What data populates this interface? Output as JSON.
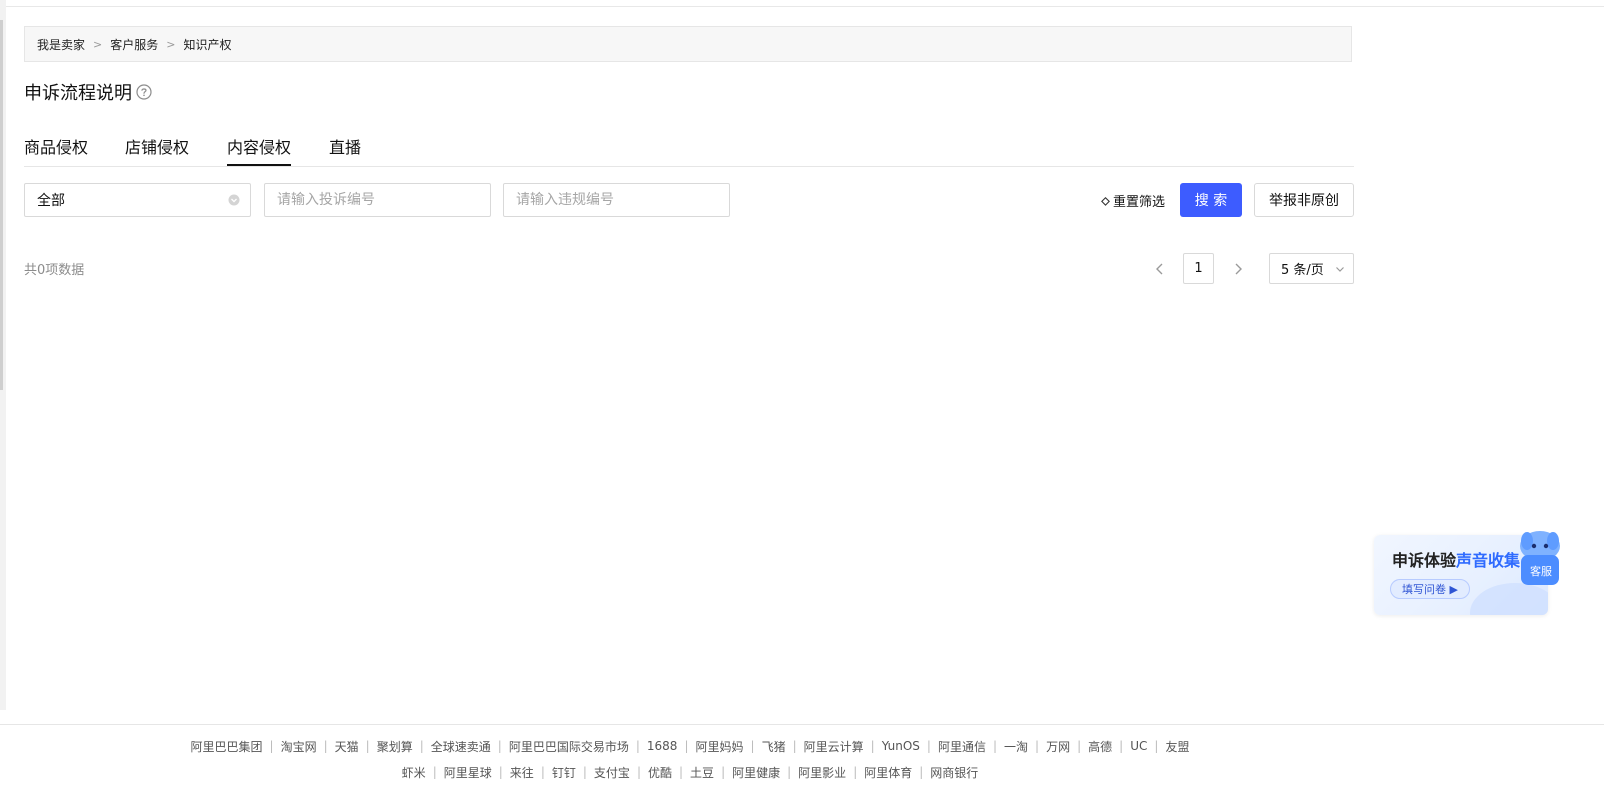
{
  "breadcrumb": [
    "我是卖家",
    "客户服务",
    "知识产权"
  ],
  "page_title": "申诉流程说明",
  "tabs": [
    {
      "label": "商品侵权"
    },
    {
      "label": "店铺侵权"
    },
    {
      "label": "内容侵权",
      "active": true
    },
    {
      "label": "直播"
    }
  ],
  "filters": {
    "type_select_value": "全部",
    "complaint_no_placeholder": "请输入投诉编号",
    "violation_no_placeholder": "请输入违规编号",
    "reset_label": "重置筛选",
    "search_label": "搜 索",
    "report_label": "举报非原创"
  },
  "results": {
    "total_text": "共0项数据"
  },
  "pagination": {
    "current_page": "1",
    "page_size": "5 条/页"
  },
  "survey": {
    "title_main": "申诉体验",
    "title_highlight": "声音收集",
    "button_label": "填写问卷 ▶"
  },
  "customer_service": {
    "label": "客服"
  },
  "footer": {
    "row1": [
      "阿里巴巴集团",
      "淘宝网",
      "天猫",
      "聚划算",
      "全球速卖通",
      "阿里巴巴国际交易市场",
      "1688",
      "阿里妈妈",
      "飞猪",
      "阿里云计算",
      "YunOS",
      "阿里通信",
      "一淘",
      "万网",
      "高德",
      "UC",
      "友盟"
    ],
    "row2": [
      "虾米",
      "阿里星球",
      "来往",
      "钉钉",
      "支付宝",
      "优酷",
      "土豆",
      "阿里健康",
      "阿里影业",
      "阿里体育",
      "网商银行"
    ]
  },
  "colors": {
    "primary": "#3d5cff",
    "survey_highlight": "#2f6bff"
  }
}
